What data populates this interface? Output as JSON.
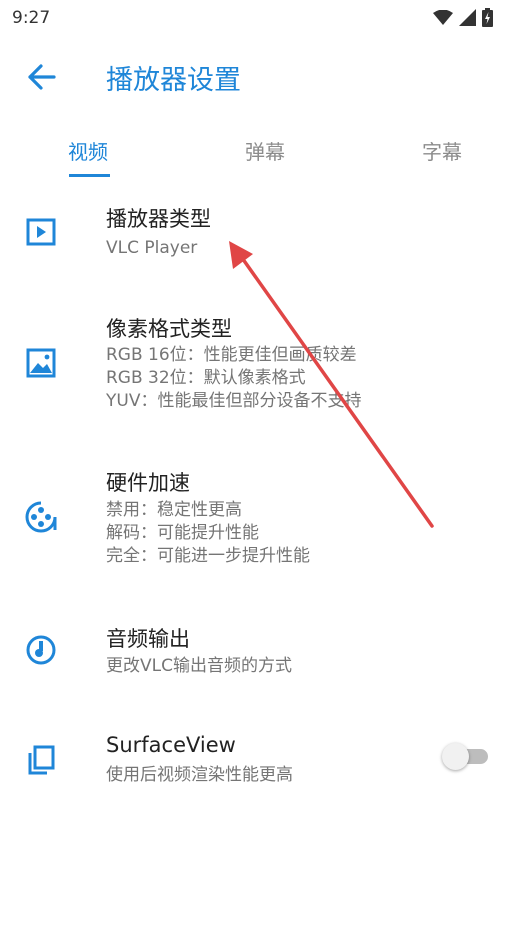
{
  "status_bar": {
    "time": "9:27"
  },
  "app_bar": {
    "title": "播放器设置"
  },
  "tabs": [
    {
      "label": "视频",
      "active": true
    },
    {
      "label": "弹幕",
      "active": false
    },
    {
      "label": "字幕",
      "active": false
    }
  ],
  "settings": [
    {
      "icon": "play-box-icon",
      "title": "播放器类型",
      "subtitle": "VLC Player"
    },
    {
      "icon": "image-icon",
      "title": "像素格式类型",
      "subtitle": "RGB 16位：性能更佳但画质较差\nRGB 32位：默认像素格式\nYUV：性能最佳但部分设备不支持"
    },
    {
      "icon": "film-reel-icon",
      "title": "硬件加速",
      "subtitle": "禁用：稳定性更高\n解码：可能提升性能\n完全：可能进一步提升性能"
    },
    {
      "icon": "audio-output-icon",
      "title": "音频输出",
      "subtitle": "更改VLC输出音频的方式"
    },
    {
      "icon": "copy-layers-icon",
      "title": "SurfaceView",
      "subtitle": "使用后视频渲染性能更高",
      "toggle_on": false
    }
  ],
  "colors": {
    "accent": "#1f86d8",
    "annotation_arrow": "#e04646"
  }
}
